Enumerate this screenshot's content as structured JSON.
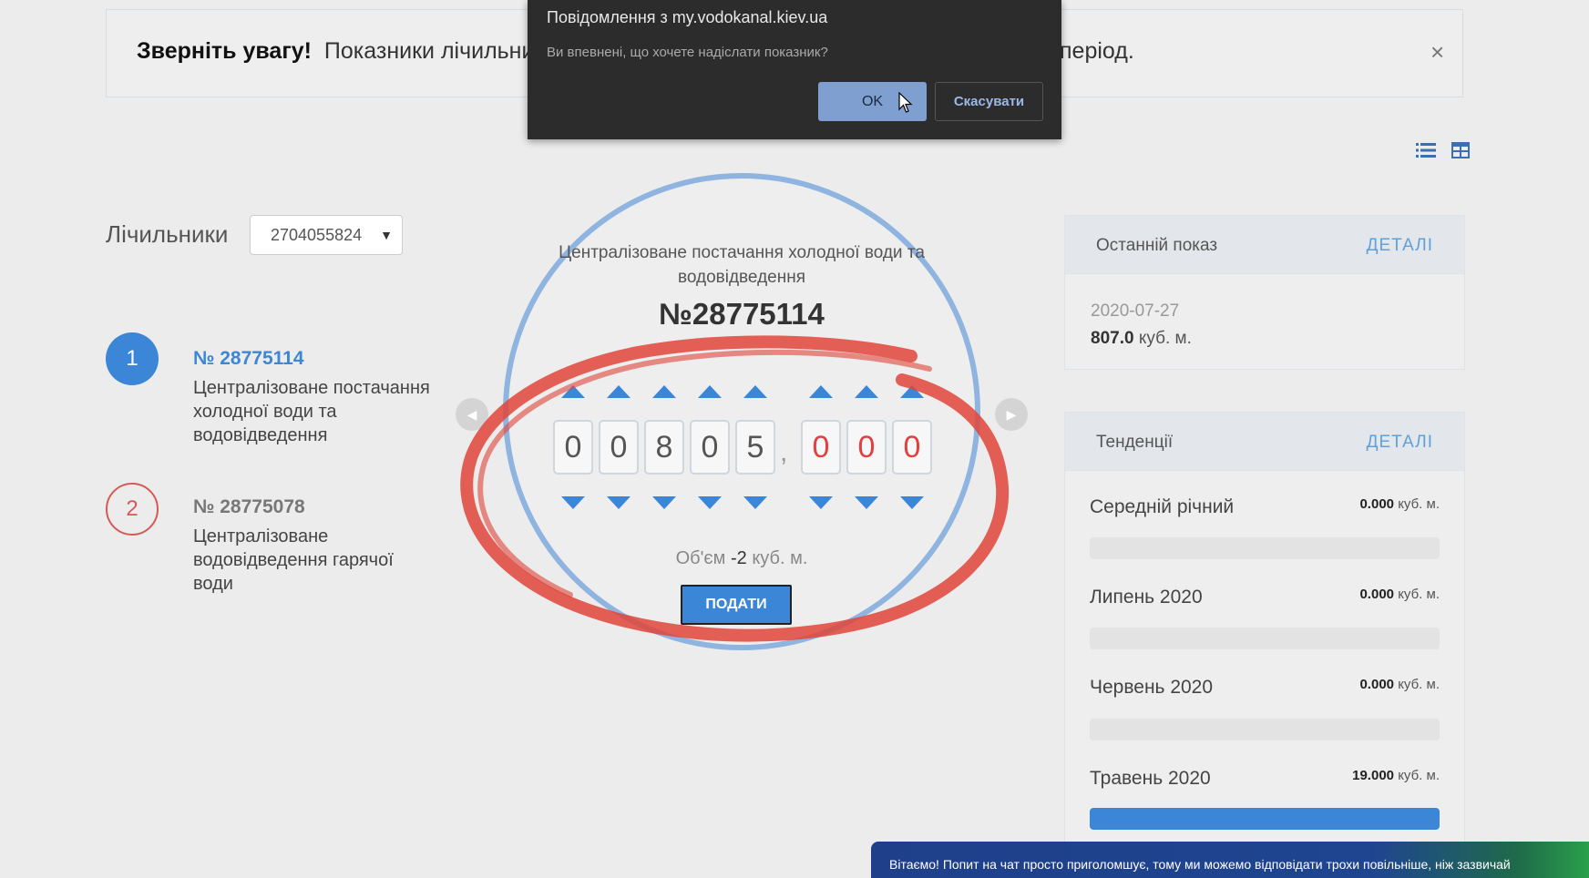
{
  "alert": {
    "strong": "Зверніть увагу!",
    "text": "Показники лічильник",
    "tail": "період.",
    "close": "×"
  },
  "dialog": {
    "title": "Повідомлення з my.vodokanal.kiev.ua",
    "message": "Ви впевнені, що хочете надіслати показник?",
    "ok_label": "OK",
    "cancel_label": "Скасувати"
  },
  "view_icons": [
    "list-view-icon",
    "table-view-icon"
  ],
  "meters": {
    "label": "Лічильники",
    "selected_account": "2704055824",
    "items": [
      {
        "step": "1",
        "number": "№ 28775114",
        "description": "Централізоване постачання холодної води та водовідведення"
      },
      {
        "step": "2",
        "number": "№ 28775078",
        "description": "Централізоване водовідведення гарячої води"
      }
    ]
  },
  "current_meter": {
    "title": "Централізоване постачання холодної води та водовідведення",
    "number": "№28775114",
    "digits": [
      "0",
      "0",
      "8",
      "0",
      "5"
    ],
    "decimals": [
      "0",
      "0",
      "0"
    ],
    "separator": ",",
    "volume_prefix": "Об'єм",
    "volume_value": "-2",
    "volume_unit": "куб. м.",
    "submit_label": "ПОДАТИ"
  },
  "last_reading": {
    "title": "Останній показ",
    "link": "ДЕТАЛІ",
    "date": "2020-07-27",
    "value": "807.0",
    "unit": "куб. м."
  },
  "trends": {
    "title": "Тенденції",
    "link": "ДЕТАЛІ",
    "items": [
      {
        "label": "Середній річний",
        "value": "0.000",
        "unit": "куб. м.",
        "fill": 0
      },
      {
        "label": "Липень 2020",
        "value": "0.000",
        "unit": "куб. м.",
        "fill": 0
      },
      {
        "label": "Червень 2020",
        "value": "0.000",
        "unit": "куб. м.",
        "fill": 0
      },
      {
        "label": "Травень 2020",
        "value": "19.000",
        "unit": "куб. м.",
        "fill": 1
      }
    ]
  },
  "chat": {
    "text": "Вітаємо! Попит на чат просто приголомшує, тому ми можемо відповідати трохи повільніше, ніж зазвичай"
  },
  "colors": {
    "accent": "#3b86d6",
    "alert_red": "#d45a55",
    "annotation_red": "#e0453a"
  }
}
